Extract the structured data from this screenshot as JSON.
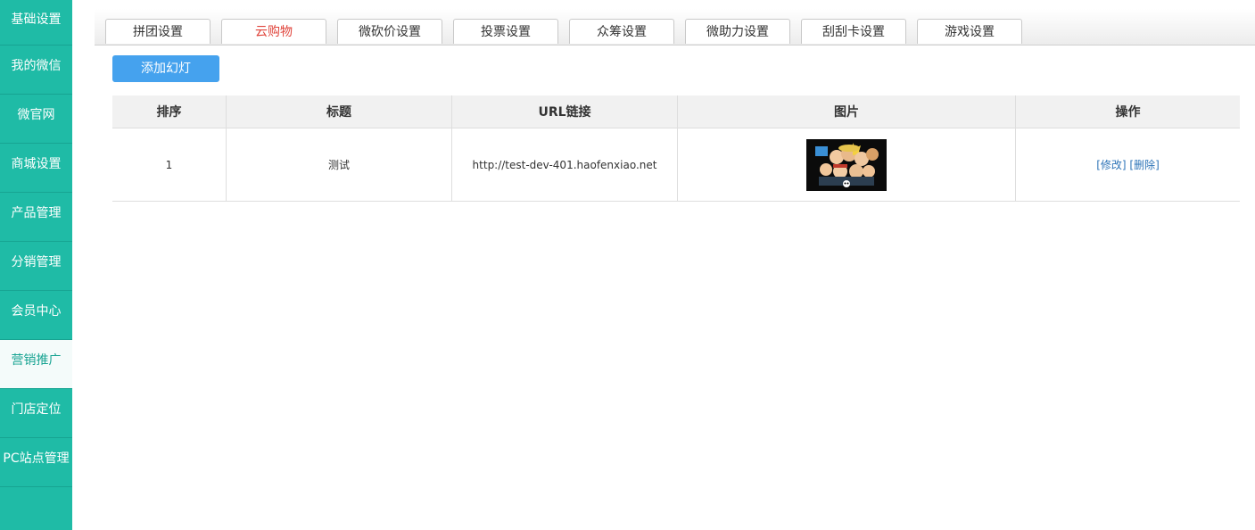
{
  "sidebar": {
    "items": [
      {
        "label": "基础设置"
      },
      {
        "label": "我的微信"
      },
      {
        "label": "微官网"
      },
      {
        "label": "商城设置"
      },
      {
        "label": "产品管理"
      },
      {
        "label": "分销管理"
      },
      {
        "label": "会员中心"
      },
      {
        "label": "营销推广"
      },
      {
        "label": "门店定位"
      },
      {
        "label": "PC站点管理"
      }
    ]
  },
  "tabs": [
    {
      "label": "拼团设置"
    },
    {
      "label": "云购物"
    },
    {
      "label": "微砍价设置"
    },
    {
      "label": "投票设置"
    },
    {
      "label": "众筹设置"
    },
    {
      "label": "微助力设置"
    },
    {
      "label": "刮刮卡设置"
    },
    {
      "label": "游戏设置"
    }
  ],
  "add_button": {
    "label": "添加幻灯"
  },
  "table": {
    "headers": [
      "排序",
      "标题",
      "URL链接",
      "图片",
      "操作"
    ],
    "rows": [
      {
        "order": "1",
        "title": "测试",
        "url": "http://test-dev-401.haofenxiao.net",
        "edit": "[修改]",
        "delete": "[删除]"
      }
    ]
  },
  "colors": {
    "sidebar_bg": "#1fbba6",
    "active_tab_text": "#e0453c",
    "primary_button": "#45a2ee",
    "link": "#2f75b8"
  }
}
